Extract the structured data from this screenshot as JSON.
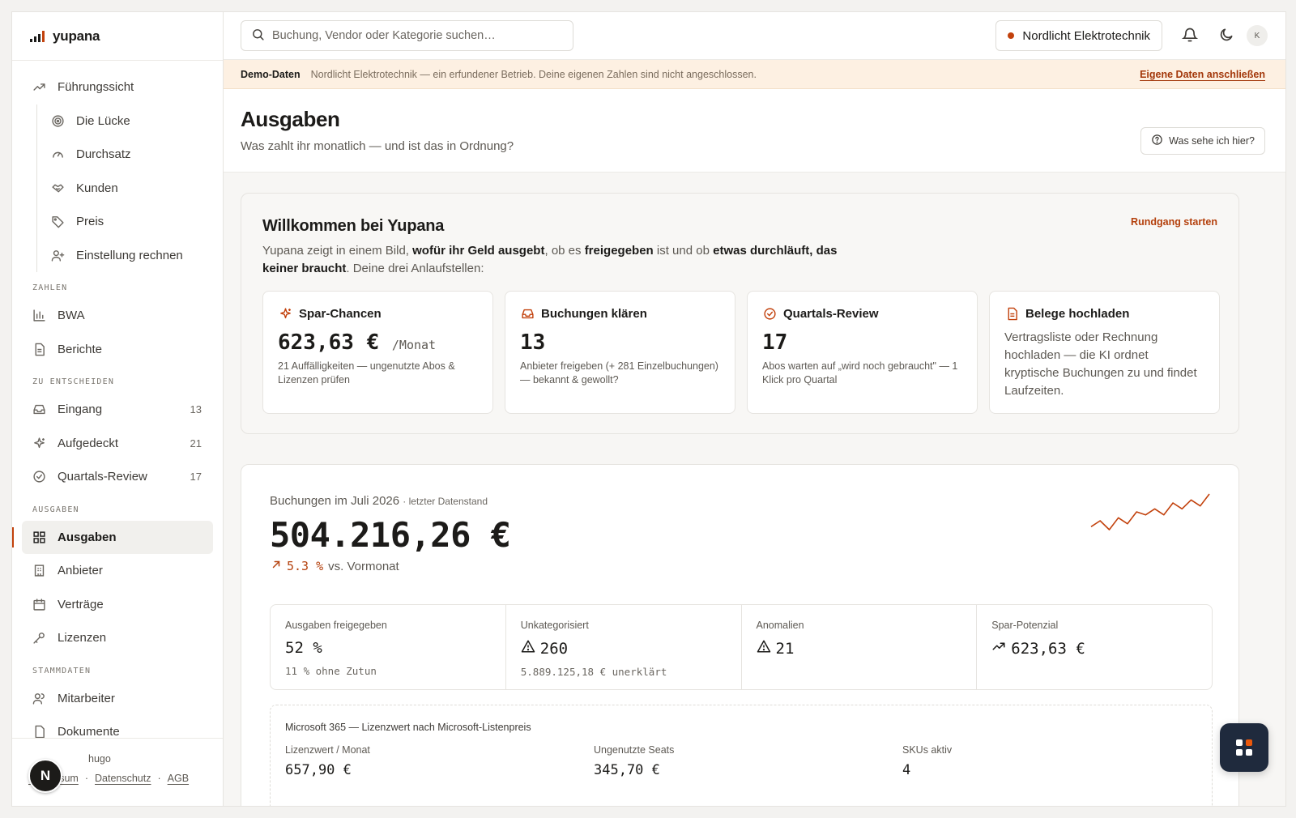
{
  "brand": {
    "name": "yupana",
    "accent": "#c2410c"
  },
  "topbar": {
    "search_placeholder": "Buchung, Vendor oder Kategorie suchen…",
    "company": "Nordlicht Elektrotechnik",
    "avatar_initial": "K"
  },
  "banner": {
    "tag": "Demo-Daten",
    "text": "Nordlicht Elektrotechnik — ein erfundener Betrieb. Deine eigenen Zahlen sind nicht angeschlossen.",
    "link": "Eigene Daten anschließen"
  },
  "sidebar": {
    "top": [
      {
        "label": "Führungssicht",
        "icon": "trend-up-icon"
      }
    ],
    "sub": [
      {
        "label": "Die Lücke",
        "icon": "target-icon"
      },
      {
        "label": "Durchsatz",
        "icon": "gauge-icon"
      },
      {
        "label": "Kunden",
        "icon": "handshake-icon"
      },
      {
        "label": "Preis",
        "icon": "tag-icon"
      },
      {
        "label": "Einstellung rechnen",
        "icon": "user-plus-icon"
      }
    ],
    "sections": {
      "zahlen": "ZAHLEN",
      "entscheiden": "ZU ENTSCHEIDEN",
      "ausgaben": "AUSGABEN",
      "stammdaten": "STAMMDATEN"
    },
    "zahlen_items": [
      {
        "label": "BWA",
        "icon": "bar-chart-icon"
      },
      {
        "label": "Berichte",
        "icon": "document-icon"
      }
    ],
    "entscheiden_items": [
      {
        "label": "Eingang",
        "icon": "inbox-icon",
        "count": "13"
      },
      {
        "label": "Aufgedeckt",
        "icon": "sparkle-icon",
        "count": "21"
      },
      {
        "label": "Quartals-Review",
        "icon": "check-circle-icon",
        "count": "17"
      }
    ],
    "ausgaben_items": [
      {
        "label": "Ausgaben",
        "icon": "dashboard-icon",
        "active": true
      },
      {
        "label": "Anbieter",
        "icon": "building-icon"
      },
      {
        "label": "Verträge",
        "icon": "calendar-icon"
      },
      {
        "label": "Lizenzen",
        "icon": "key-icon"
      }
    ],
    "stammdaten_items": [
      {
        "label": "Mitarbeiter",
        "icon": "users-icon"
      },
      {
        "label": "Dokumente",
        "icon": "file-icon"
      }
    ],
    "footer": {
      "user": "hugo",
      "links": [
        "Impressum",
        "Datenschutz",
        "AGB"
      ],
      "badge": "N"
    }
  },
  "page": {
    "title": "Ausgaben",
    "subtitle": "Was zahlt ihr monatlich — und ist das in Ordnung?",
    "help": "Was sehe ich hier?"
  },
  "welcome": {
    "title": "Willkommen bei Yupana",
    "tour": "Rundgang starten",
    "intro_1": "Yupana zeigt in einem Bild, ",
    "intro_b1": "wofür ihr Geld ausgebt",
    "intro_2": ", ob es ",
    "intro_b2": "freigegeben",
    "intro_3": " ist und ob ",
    "intro_b3": "etwas durchläuft, das keiner braucht",
    "intro_4": ". Deine drei Anlaufstellen:",
    "cards": [
      {
        "title": "Spar-Chancen",
        "icon": "sparkle-icon",
        "value": "623,63 €",
        "unit": "/Monat",
        "desc": "21 Auffälligkeiten — ungenutzte Abos & Lizenzen prüfen"
      },
      {
        "title": "Buchungen klären",
        "icon": "inbox-icon",
        "value": "13",
        "desc": "Anbieter freigeben (+ 281 Einzelbuchungen) — bekannt & gewollt?"
      },
      {
        "title": "Quartals-Review",
        "icon": "check-circle-icon",
        "value": "17",
        "desc": "Abos warten auf „wird noch gebraucht\" — 1 Klick pro Quartal"
      },
      {
        "title": "Belege hochladen",
        "icon": "document-icon",
        "text": "Vertragsliste oder Rechnung hochladen — die KI ordnet kryptische Buchungen zu und findet Laufzeiten."
      }
    ]
  },
  "bookings": {
    "label": "Buchungen im Juli 2026",
    "label_note": "· letzter Datenstand",
    "total": "504.216,26 €",
    "delta_value": "5.3 %",
    "delta_text": "vs. Vormonat",
    "trend": [
      3,
      5,
      2,
      6,
      4,
      8,
      7,
      9,
      7,
      11,
      9,
      12,
      10,
      14
    ]
  },
  "kpis": [
    {
      "label": "Ausgaben freigegeben",
      "value": "52 %",
      "sub": "11 % ohne Zutun",
      "tone": "neutral"
    },
    {
      "label": "Unkategorisiert",
      "value": "260",
      "sub": "5.889.125,18 € unerklärt",
      "tone": "warn",
      "icon": "warning-icon"
    },
    {
      "label": "Anomalien",
      "value": "21",
      "sub": "",
      "tone": "warn",
      "icon": "warning-icon"
    },
    {
      "label": "Spar-Potenzial",
      "value": "623,63 €",
      "sub": "",
      "tone": "good",
      "icon": "trend-up-icon"
    }
  ],
  "microsoft": {
    "title": "Microsoft 365 — Lizenzwert nach Microsoft-Listenpreis",
    "cols": [
      {
        "label": "Lizenzwert / Monat",
        "value": "657,90 €",
        "tone": "neutral"
      },
      {
        "label": "Ungenutzte Seats",
        "value": "345,70 €",
        "tone": "warn"
      },
      {
        "label": "SKUs aktiv",
        "value": "4",
        "tone": "neutral"
      }
    ]
  }
}
